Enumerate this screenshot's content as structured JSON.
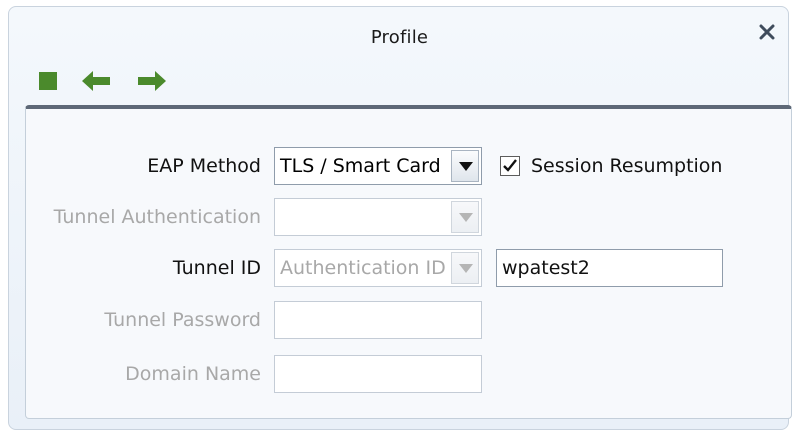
{
  "window": {
    "title": "Profile",
    "close_label": "×"
  },
  "toolbar": {
    "icons": [
      "stop-icon",
      "back-arrow-icon",
      "forward-arrow-icon"
    ],
    "icon_color": "#4b8a2c"
  },
  "form": {
    "eap_method": {
      "label": "EAP Method",
      "value": "TLS / Smart Card",
      "enabled": true
    },
    "session_resumption": {
      "label": "Session Resumption",
      "checked": true
    },
    "tunnel_authentication": {
      "label": "Tunnel Authentication",
      "value": "",
      "enabled": false
    },
    "tunnel_id": {
      "label": "Tunnel ID",
      "type_value": "Authentication ID",
      "value": "wpatest2",
      "enabled": true
    },
    "tunnel_password": {
      "label": "Tunnel Password",
      "value": "",
      "enabled": false
    },
    "domain_name": {
      "label": "Domain Name",
      "value": "",
      "enabled": false
    }
  }
}
